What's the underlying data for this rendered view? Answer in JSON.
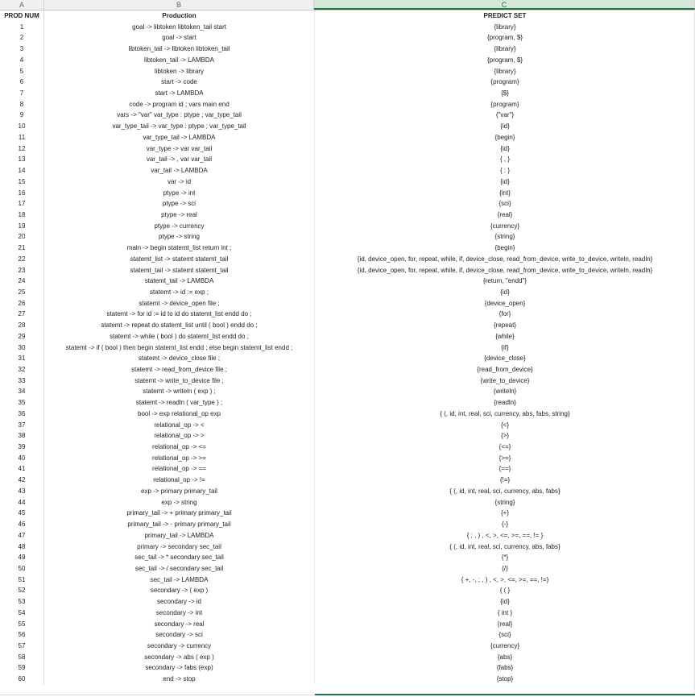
{
  "columns": [
    "A",
    "B",
    "C"
  ],
  "headers": {
    "prod_num": "PROD NUM",
    "production": "Production",
    "predict_set": "PREDICT SET"
  },
  "rows": [
    {
      "n": "1",
      "p": "goal -> libtoken libtoken_tail start",
      "s": "{library}"
    },
    {
      "n": "2",
      "p": "goal -> start",
      "s": "{program, $}"
    },
    {
      "n": "3",
      "p": "libtoken_tail -> libtoken libtoken_tail",
      "s": "{library}"
    },
    {
      "n": "4",
      "p": "libtoken_tail -> LAMBDA",
      "s": "{program, $}"
    },
    {
      "n": "5",
      "p": "libtoken -> library",
      "s": "{library}"
    },
    {
      "n": "6",
      "p": "start -> code",
      "s": "{program}"
    },
    {
      "n": "7",
      "p": "start -> LAMBDA",
      "s": "{$}"
    },
    {
      "n": "8",
      "p": "code -> program id ; vars main end",
      "s": "{program}"
    },
    {
      "n": "9",
      "p": "vars -> \"var\" var_type : ptype ; var_type_tail",
      "s": "{\"var\"}"
    },
    {
      "n": "10",
      "p": "var_type_tail -> var_type : ptype ; var_type_tail",
      "s": "{id}"
    },
    {
      "n": "11",
      "p": "var_type_tail -> LAMBDA",
      "s": "{begin}"
    },
    {
      "n": "12",
      "p": "var_type -> var var_tail",
      "s": "{id}"
    },
    {
      "n": "13",
      "p": "var_tail -> , var var_tail",
      "s": "{ , }"
    },
    {
      "n": "14",
      "p": "var_tail -> LAMBDA",
      "s": "{ : }"
    },
    {
      "n": "15",
      "p": "var -> id",
      "s": "{id}"
    },
    {
      "n": "16",
      "p": "ptype -> int",
      "s": "{int}"
    },
    {
      "n": "17",
      "p": "ptype -> sci",
      "s": "{sci}"
    },
    {
      "n": "18",
      "p": "ptype -> real",
      "s": "{real}"
    },
    {
      "n": "19",
      "p": "ptype -> currency",
      "s": "{currency}"
    },
    {
      "n": "20",
      "p": "ptype -> string",
      "s": "{string}"
    },
    {
      "n": "21",
      "p": "main -> begin statemt_list return int ;",
      "s": "{begin}"
    },
    {
      "n": "22",
      "p": "statemt_list -> statemt statemt_tail",
      "s": "{id, device_open, for, repeat, while, if, device_close, read_from_device, write_to_device, writeln, readln}"
    },
    {
      "n": "23",
      "p": "statemt_tail -> statemt statemt_tail",
      "s": "{id, device_open, for, repeat, while, if, device_close, read_from_device, write_to_device, writeln, readln}"
    },
    {
      "n": "24",
      "p": "statemt_tail -> LAMBDA",
      "s": "{return, \"endd\"}"
    },
    {
      "n": "25",
      "p": "statemt -> id := exp ;",
      "s": "{id}"
    },
    {
      "n": "26",
      "p": "statemt -> device_open file ;",
      "s": "{device_open}"
    },
    {
      "n": "27",
      "p": "statemt -> for id := id to id do statemt_list endd do ;",
      "s": "{for}"
    },
    {
      "n": "28",
      "p": "statemt -> repeat do statemt_list until ( bool ) endd do ;",
      "s": "{repeat}"
    },
    {
      "n": "29",
      "p": "statemt -> while ( bool ) do statemt_list endd do ;",
      "s": "{while}"
    },
    {
      "n": "30",
      "p": "statemt -> if ( bool ) then begin statemt_list endd ; else begin statemt_list endd ;",
      "s": "{if}"
    },
    {
      "n": "31",
      "p": "statemt -> device_close file ;",
      "s": "{device_close}"
    },
    {
      "n": "32",
      "p": "statemt -> read_from_device file ;",
      "s": "{read_from_device}"
    },
    {
      "n": "33",
      "p": "statemt -> write_to_device file ;",
      "s": "{write_to_device}"
    },
    {
      "n": "34",
      "p": "statemt -> writeln ( exp ) ;",
      "s": "{writeln}"
    },
    {
      "n": "35",
      "p": "statemt -> readln ( var_type ) ;",
      "s": "{readln}"
    },
    {
      "n": "36",
      "p": "bool -> exp relational_op exp",
      "s": "{ (, id, int, real, sci, currency, abs, fabs, string}"
    },
    {
      "n": "37",
      "p": "relational_op -> <",
      "s": "{<}"
    },
    {
      "n": "38",
      "p": "relational_op -> >",
      "s": "{>}"
    },
    {
      "n": "39",
      "p": "relational_op -> <=",
      "s": "{<=}"
    },
    {
      "n": "40",
      "p": "relational_op -> >=",
      "s": "{>=}"
    },
    {
      "n": "41",
      "p": "relational_op -> ==",
      "s": "{==}"
    },
    {
      "n": "42",
      "p": "relational_op -> !=",
      "s": "{!=}"
    },
    {
      "n": "43",
      "p": "exp -> primary primary_tail",
      "s": "{ (, id, int, real, sci, currency, abs, fabs}"
    },
    {
      "n": "44",
      "p": "exp -> string",
      "s": "{string}"
    },
    {
      "n": "45",
      "p": "primary_tail -> + primary primary_tail",
      "s": "{+}"
    },
    {
      "n": "46",
      "p": "primary_tail -> - primary primary_tail",
      "s": "{-}"
    },
    {
      "n": "47",
      "p": "primary_tail -> LAMBDA",
      "s": "{ ; , ) , <, >, <=, >=, ==, != }"
    },
    {
      "n": "48",
      "p": "primary -> secondary sec_tail",
      "s": "{ (, id, int, real, sci, currency, abs, fabs}"
    },
    {
      "n": "49",
      "p": "sec_tail -> * secondary sec_tail",
      "s": "{*}"
    },
    {
      "n": "50",
      "p": "sec_tail -> / secondary sec_tail",
      "s": "{/}"
    },
    {
      "n": "51",
      "p": "sec_tail -> LAMBDA",
      "s": "{ +, -, ; , ) , <, >, <=, >=, ==, !=}"
    },
    {
      "n": "52",
      "p": "secondary -> ( exp )",
      "s": "{ ( }"
    },
    {
      "n": "53",
      "p": "secondary -> id",
      "s": "{id}"
    },
    {
      "n": "54",
      "p": "secondary -> int",
      "s": "{ int }"
    },
    {
      "n": "55",
      "p": "secondary -> real",
      "s": "{real}"
    },
    {
      "n": "56",
      "p": "secondary -> sci",
      "s": "{sci}"
    },
    {
      "n": "57",
      "p": "secondary -> currency",
      "s": "{currency}"
    },
    {
      "n": "58",
      "p": "secondary -> abs ( exp )",
      "s": "{abs}"
    },
    {
      "n": "59",
      "p": "secondary -> fabs (exp)",
      "s": "{fabs}"
    },
    {
      "n": "60",
      "p": "end -> stop",
      "s": "{stop}"
    }
  ]
}
